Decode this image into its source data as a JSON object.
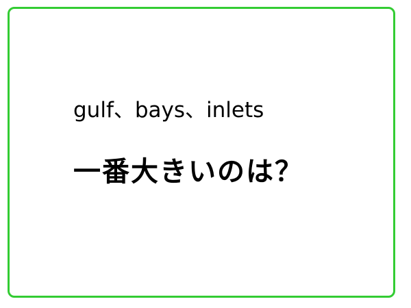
{
  "card": {
    "border_color": "#33cc33",
    "line1": "gulf、bays、inlets",
    "line2": "一番大きいのは？"
  }
}
